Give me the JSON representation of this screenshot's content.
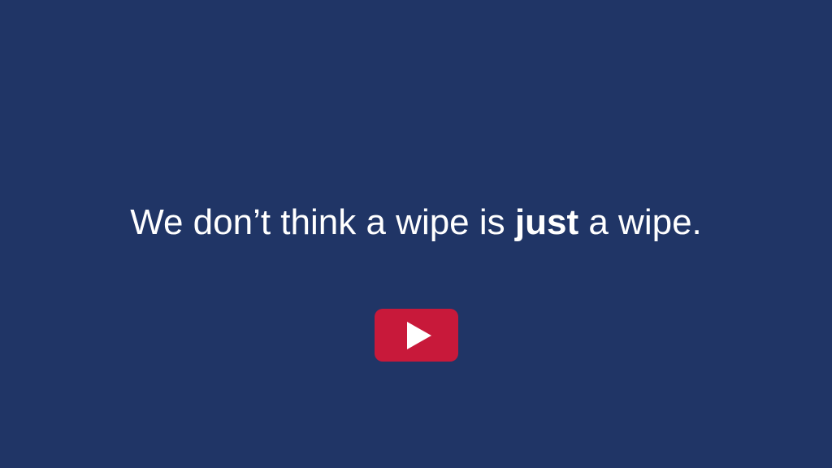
{
  "colors": {
    "background": "#203566",
    "text": "#ffffff",
    "play_button": "#c8193a",
    "play_icon": "#ffffff"
  },
  "headline": {
    "before": "We don’t think a wipe is ",
    "emphasis": "just",
    "after": " a wipe."
  },
  "play_button": {
    "icon": "play-icon"
  }
}
